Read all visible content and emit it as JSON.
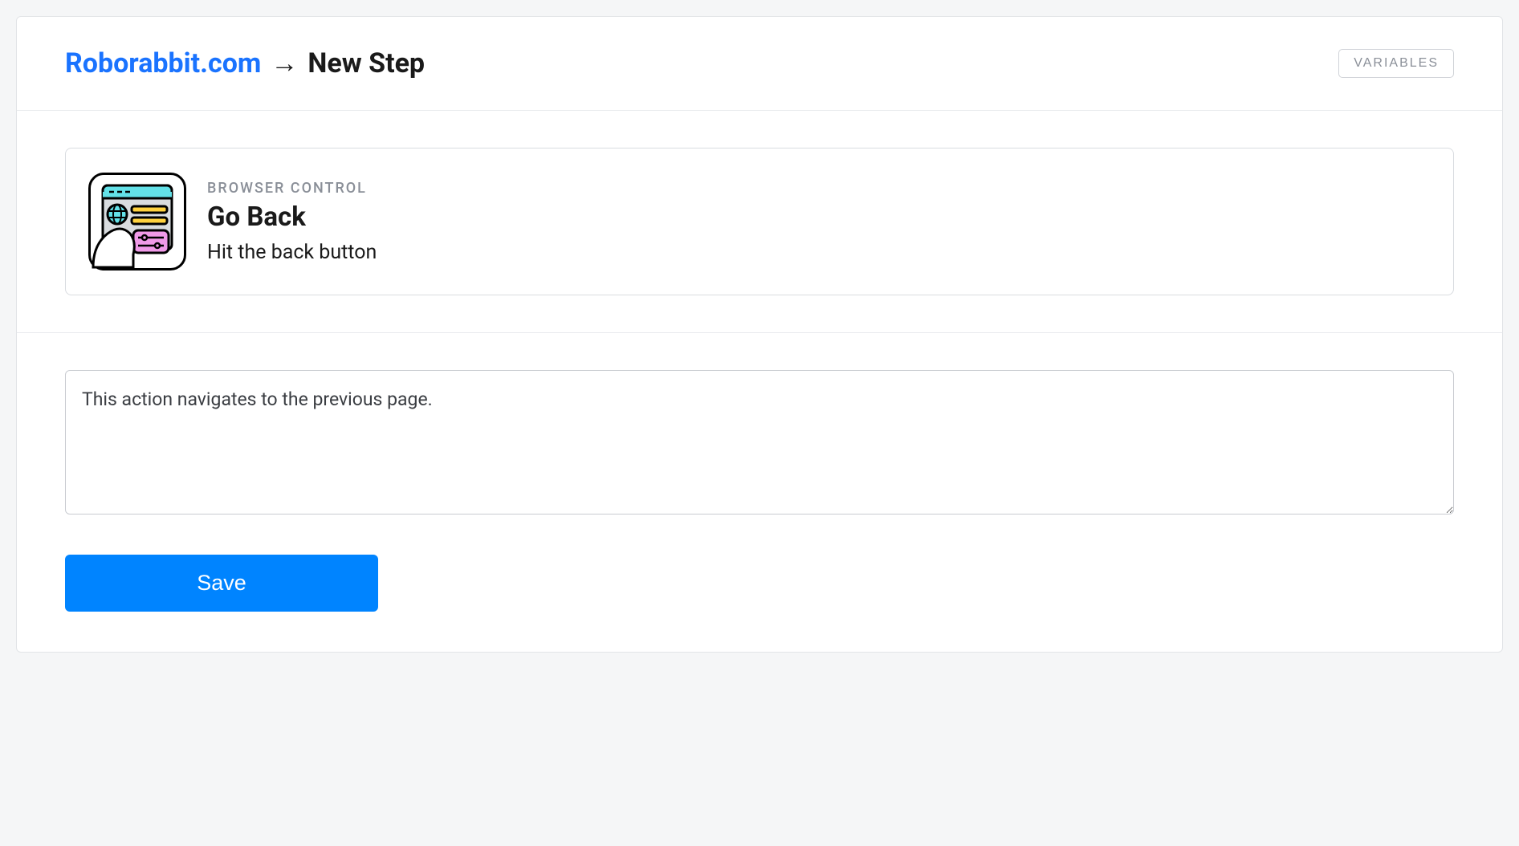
{
  "header": {
    "breadcrumb_link": "Roborabbit.com",
    "breadcrumb_arrow": "→",
    "breadcrumb_current": "New Step",
    "variables_button": "VARIABLES"
  },
  "step": {
    "category": "BROWSER CONTROL",
    "title": "Go Back",
    "description": "Hit the back button"
  },
  "form": {
    "description_value": "This action navigates to the previous page.",
    "save_label": "Save"
  },
  "colors": {
    "accent": "#0084ff",
    "link": "#1a73ff"
  }
}
